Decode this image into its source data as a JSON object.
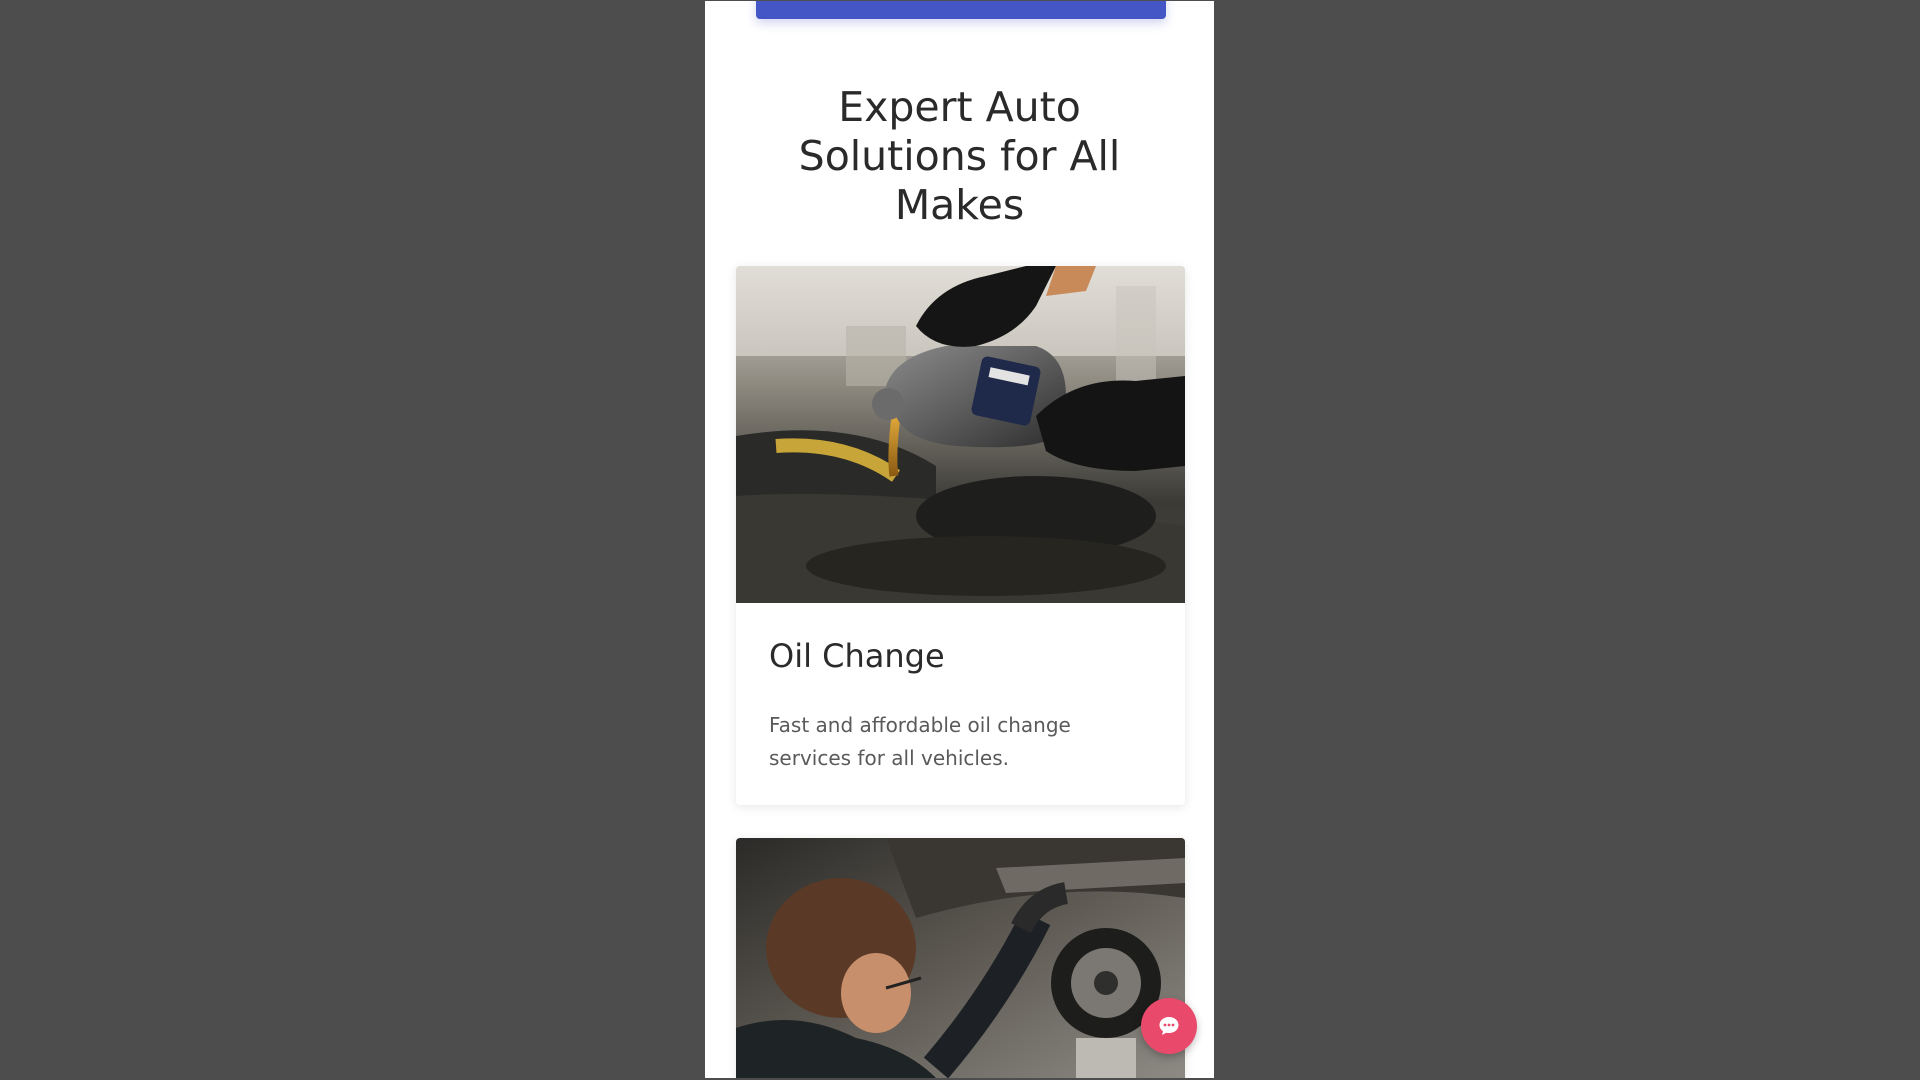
{
  "section": {
    "heading": "Expert Auto Solutions for All Makes"
  },
  "services": [
    {
      "title": "Oil Change",
      "description": "Fast and affordable oil change services for all vehicles.",
      "image": "oil-change-photo"
    },
    {
      "title": "",
      "description": "",
      "image": "mechanic-under-car-photo"
    }
  ],
  "colors": {
    "page_background": "#4d4d4d",
    "primary": "#4455c5",
    "chat_button": "#e94a6b"
  },
  "icons": {
    "chat": "chat-bubble-icon"
  }
}
